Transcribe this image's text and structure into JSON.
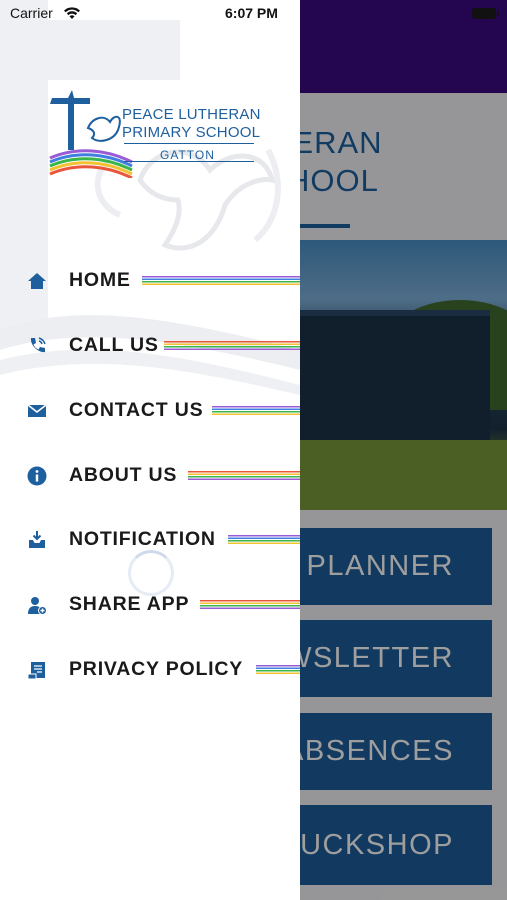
{
  "status_bar": {
    "carrier": "Carrier",
    "time": "6:07 PM"
  },
  "drawer": {
    "logo": {
      "line1": "PEACE LUTHERAN",
      "line2": "PRIMARY SCHOOL",
      "line3": "GATTON"
    },
    "menu_items": [
      {
        "label": "HOME",
        "icon": "home-icon"
      },
      {
        "label": "CALL US",
        "icon": "phone-icon"
      },
      {
        "label": "CONTACT US",
        "icon": "envelope-icon"
      },
      {
        "label": "ABOUT US",
        "icon": "info-icon"
      },
      {
        "label": "NOTIFICATION",
        "icon": "inbox-download-icon"
      },
      {
        "label": "SHARE APP",
        "icon": "user-add-icon"
      },
      {
        "label": "PRIVACY POLICY",
        "icon": "certificate-icon"
      }
    ]
  },
  "main": {
    "title_line1": "LUTHERAN",
    "title_line2": "Y SCHOOL",
    "tiles": [
      "PLANNER",
      "WSLETTER",
      "ABSENCES",
      "TUCKSHOP"
    ]
  },
  "colors": {
    "brand_blue": "#1e5f9e",
    "top_bar_purple": "#3a0a82",
    "tile_blue": "#1d5c9a",
    "drawer_background": "#ffffff"
  }
}
